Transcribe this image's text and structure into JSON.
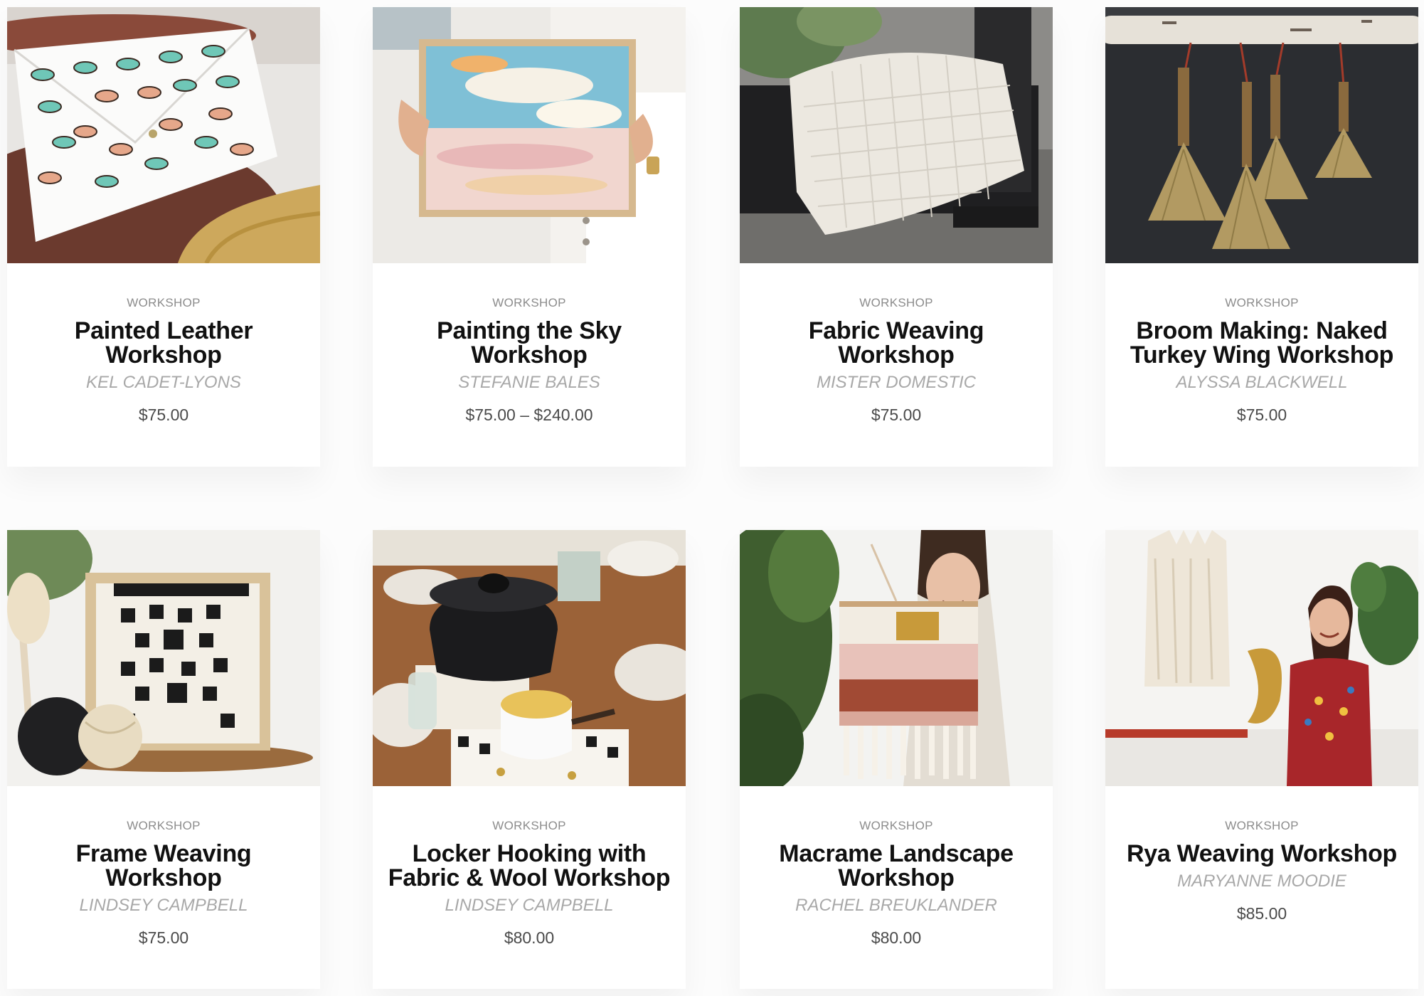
{
  "products": [
    {
      "category": "WORKSHOP",
      "title": "Painted Leather Workshop",
      "artist": "KEL CADET-LYONS",
      "price": "$75.00",
      "image": "painted-leather-clutch"
    },
    {
      "category": "WORKSHOP",
      "title": "Painting the Sky Workshop",
      "artist": "STEFANIE BALES",
      "price": "$75.00 – $240.00",
      "image": "sky-painting"
    },
    {
      "category": "WORKSHOP",
      "title": "Fabric Weaving Workshop",
      "artist": "MISTER DOMESTIC",
      "price": "$75.00",
      "image": "woven-pillow"
    },
    {
      "category": "WORKSHOP",
      "title": "Broom Making: Naked Turkey Wing Workshop",
      "artist": "ALYSSA BLACKWELL",
      "price": "$75.00",
      "image": "hanging-brooms"
    },
    {
      "category": "WORKSHOP",
      "title": "Frame Weaving Workshop",
      "artist": "LINDSEY CAMPBELL",
      "price": "$75.00",
      "image": "frame-weaving"
    },
    {
      "category": "WORKSHOP",
      "title": "Locker Hooking with Fabric & Wool Workshop",
      "artist": "LINDSEY CAMPBELL",
      "price": "$80.00",
      "image": "locker-hooking-table"
    },
    {
      "category": "WORKSHOP",
      "title": "Macrame Landscape Workshop",
      "artist": "RACHEL BREUKLANDER",
      "price": "$80.00",
      "image": "macrame-landscape"
    },
    {
      "category": "WORKSHOP",
      "title": "Rya Weaving Workshop",
      "artist": "MARYANNE MOODIE",
      "price": "$85.00",
      "image": "rya-weaving"
    }
  ]
}
